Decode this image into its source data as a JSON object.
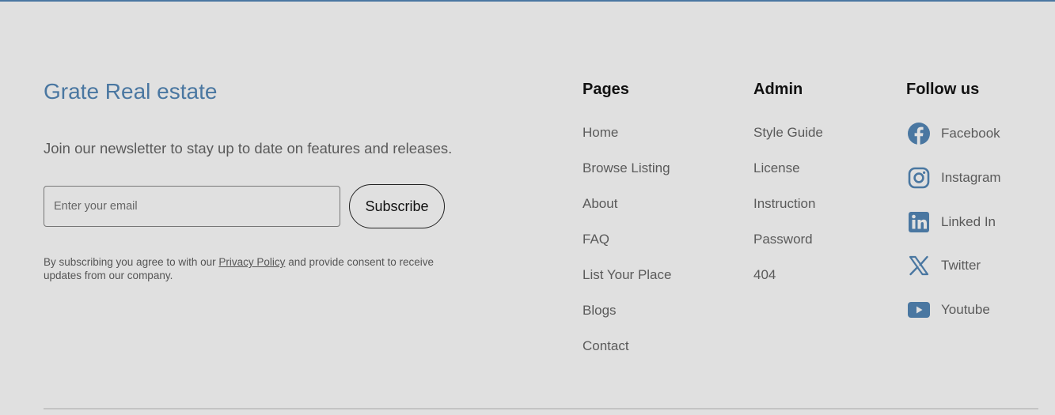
{
  "brand": "Grate Real estate",
  "newsletter": {
    "text": "Join our newsletter to stay up to date on features and releases.",
    "email_placeholder": "Enter your email",
    "subscribe_label": "Subscribe",
    "consent_before": "By subscribing you agree to with our",
    "privacy_link": "Privacy Policy",
    "consent_after": "and provide consent to receive updates from our company."
  },
  "pages": {
    "heading": "Pages",
    "items": [
      "Home",
      "Browse Listing",
      "About",
      "FAQ",
      "List Your Place",
      "Blogs",
      "Contact"
    ]
  },
  "admin": {
    "heading": "Admin",
    "items": [
      "Style Guide",
      "License",
      "Instruction",
      "Password",
      "404"
    ]
  },
  "follow": {
    "heading": "Follow us",
    "items": [
      {
        "label": "Facebook",
        "icon": "facebook-icon"
      },
      {
        "label": "Instagram",
        "icon": "instagram-icon"
      },
      {
        "label": "Linked In",
        "icon": "linkedin-icon"
      },
      {
        "label": "Twitter",
        "icon": "twitter-x-icon"
      },
      {
        "label": "Youtube",
        "icon": "youtube-icon"
      }
    ]
  },
  "colors": {
    "accent": "#4a77a1",
    "background": "#e0e0e0",
    "text": "#5a5a5a",
    "heading": "#111111"
  }
}
